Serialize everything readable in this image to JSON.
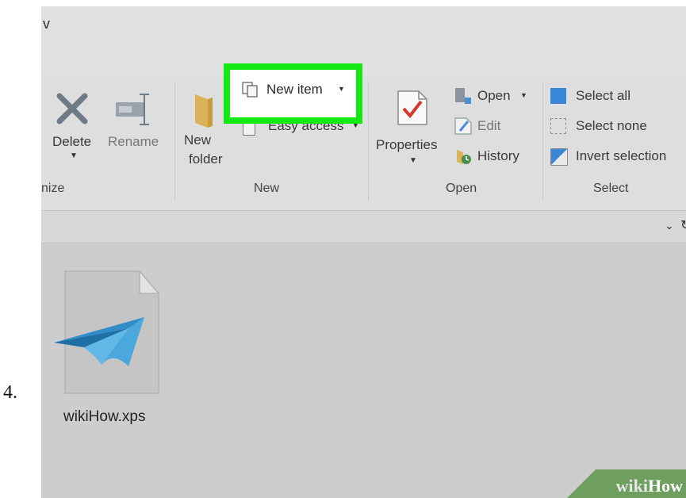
{
  "step": {
    "number": "4."
  },
  "window": {
    "title_fragment": "v"
  },
  "ribbon": {
    "organize": {
      "group_label": "nize",
      "delete_label": "Delete",
      "rename_label": "Rename"
    },
    "new": {
      "group_label": "New",
      "new_folder_line1": "New",
      "new_folder_line2": "folder",
      "new_item_label": "New item",
      "easy_access_label": "Easy access"
    },
    "open": {
      "group_label": "Open",
      "properties_label": "Properties",
      "open_label": "Open",
      "edit_label": "Edit",
      "history_label": "History"
    },
    "select": {
      "group_label": "Select",
      "select_all_label": "Select all",
      "select_none_label": "Select none",
      "invert_selection_label": "Invert selection"
    }
  },
  "content": {
    "files": [
      {
        "name": "wikiHow.xps",
        "icon": "xps-document-icon"
      }
    ]
  },
  "watermark": {
    "part1": "wiki",
    "part2": "How"
  },
  "colors": {
    "highlight": "#13ea13",
    "delete_x": "#6f7a86",
    "check": "#d33a2c"
  }
}
